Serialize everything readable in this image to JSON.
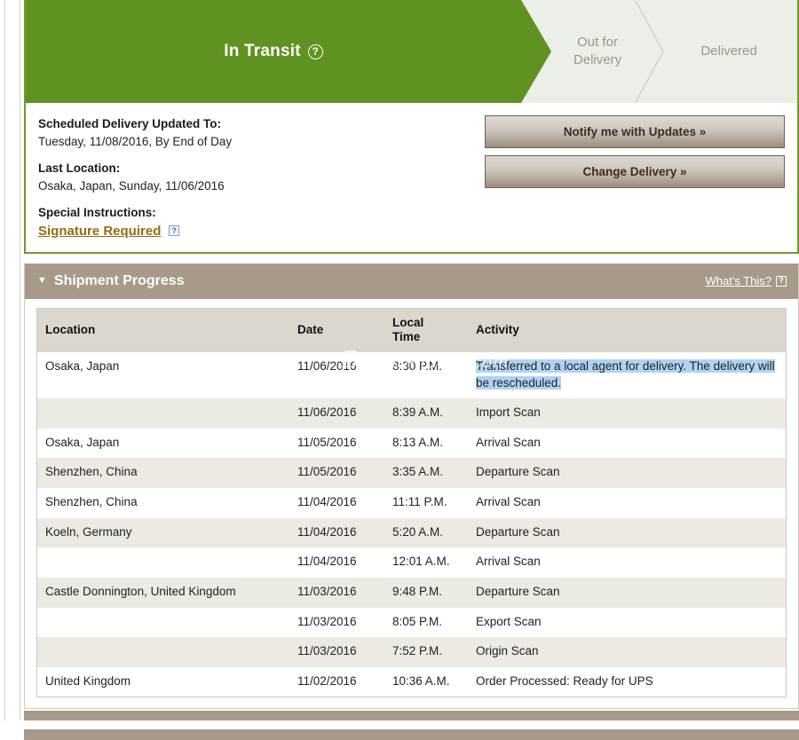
{
  "status_bar": {
    "current": {
      "label": "In Transit",
      "help_icon": "question-mark-circle-icon",
      "help_glyph": "?",
      "color": "#5f9220"
    },
    "steps": [
      {
        "label": "Out for\nDelivery",
        "line1": "Out for",
        "line2": "Delivery",
        "active": false
      },
      {
        "label": "Delivered",
        "line1": "Delivered",
        "line2": "",
        "active": false
      }
    ]
  },
  "details": {
    "scheduled_label": "Scheduled Delivery Updated To:",
    "scheduled_value": "Tuesday, 11/08/2016, By End of Day",
    "last_location_label": "Last Location:",
    "last_location_value": "Osaka, Japan, Sunday, 11/06/2016",
    "special_instructions_label": "Special Instructions:",
    "special_instructions_value": "Signature Required",
    "special_instructions_help_glyph": "?"
  },
  "actions": {
    "notify_label": "Notify me with Updates »",
    "change_label": "Change Delivery »"
  },
  "shipment_progress": {
    "caret_glyph": "▼",
    "title": "Shipment Progress",
    "whats_this_label": "What's This?",
    "whats_this_help_glyph": "?",
    "columns": [
      "Location",
      "Date",
      "Local Time",
      "Activity"
    ],
    "column_time_line1": "Local",
    "column_time_line2": "Time",
    "rows": [
      {
        "location": "Osaka, Japan",
        "date": "11/06/2016",
        "time": "8:30 P.M.",
        "activity": "Transferred to a local agent for delivery. The delivery will be rescheduled.",
        "highlighted": true,
        "shade": "white"
      },
      {
        "location": "",
        "date": "11/06/2016",
        "time": "8:39 A.M.",
        "activity": "Import Scan",
        "highlighted": false,
        "shade": "gray"
      },
      {
        "location": "Osaka, Japan",
        "date": "11/05/2016",
        "time": "8:13 A.M.",
        "activity": "Arrival Scan",
        "highlighted": false,
        "shade": "white"
      },
      {
        "location": "Shenzhen, China",
        "date": "11/05/2016",
        "time": "3:35 A.M.",
        "activity": "Departure Scan",
        "highlighted": false,
        "shade": "gray"
      },
      {
        "location": "Shenzhen, China",
        "date": "11/04/2016",
        "time": "11:11 P.M.",
        "activity": "Arrival Scan",
        "highlighted": false,
        "shade": "white"
      },
      {
        "location": "Koeln, Germany",
        "date": "11/04/2016",
        "time": "5:20 A.M.",
        "activity": "Departure Scan",
        "highlighted": false,
        "shade": "gray"
      },
      {
        "location": "",
        "date": "11/04/2016",
        "time": "12:01 A.M.",
        "activity": "Arrival Scan",
        "highlighted": false,
        "shade": "white"
      },
      {
        "location": "Castle Donnington, United Kingdom",
        "date": "11/03/2016",
        "time": "9:48 P.M.",
        "activity": "Departure Scan",
        "highlighted": false,
        "shade": "gray"
      },
      {
        "location": "",
        "date": "11/03/2016",
        "time": "8:05 P.M.",
        "activity": "Export Scan",
        "highlighted": false,
        "shade": "white"
      },
      {
        "location": "",
        "date": "11/03/2016",
        "time": "7:52 P.M.",
        "activity": "Origin Scan",
        "highlighted": false,
        "shade": "gray"
      },
      {
        "location": "United Kingdom",
        "date": "11/02/2016",
        "time": "10:36 A.M.",
        "activity": "Order Processed: Ready for UPS",
        "highlighted": false,
        "shade": "white"
      }
    ]
  },
  "watermark": {
    "text": "Beauty-hacks.com"
  }
}
